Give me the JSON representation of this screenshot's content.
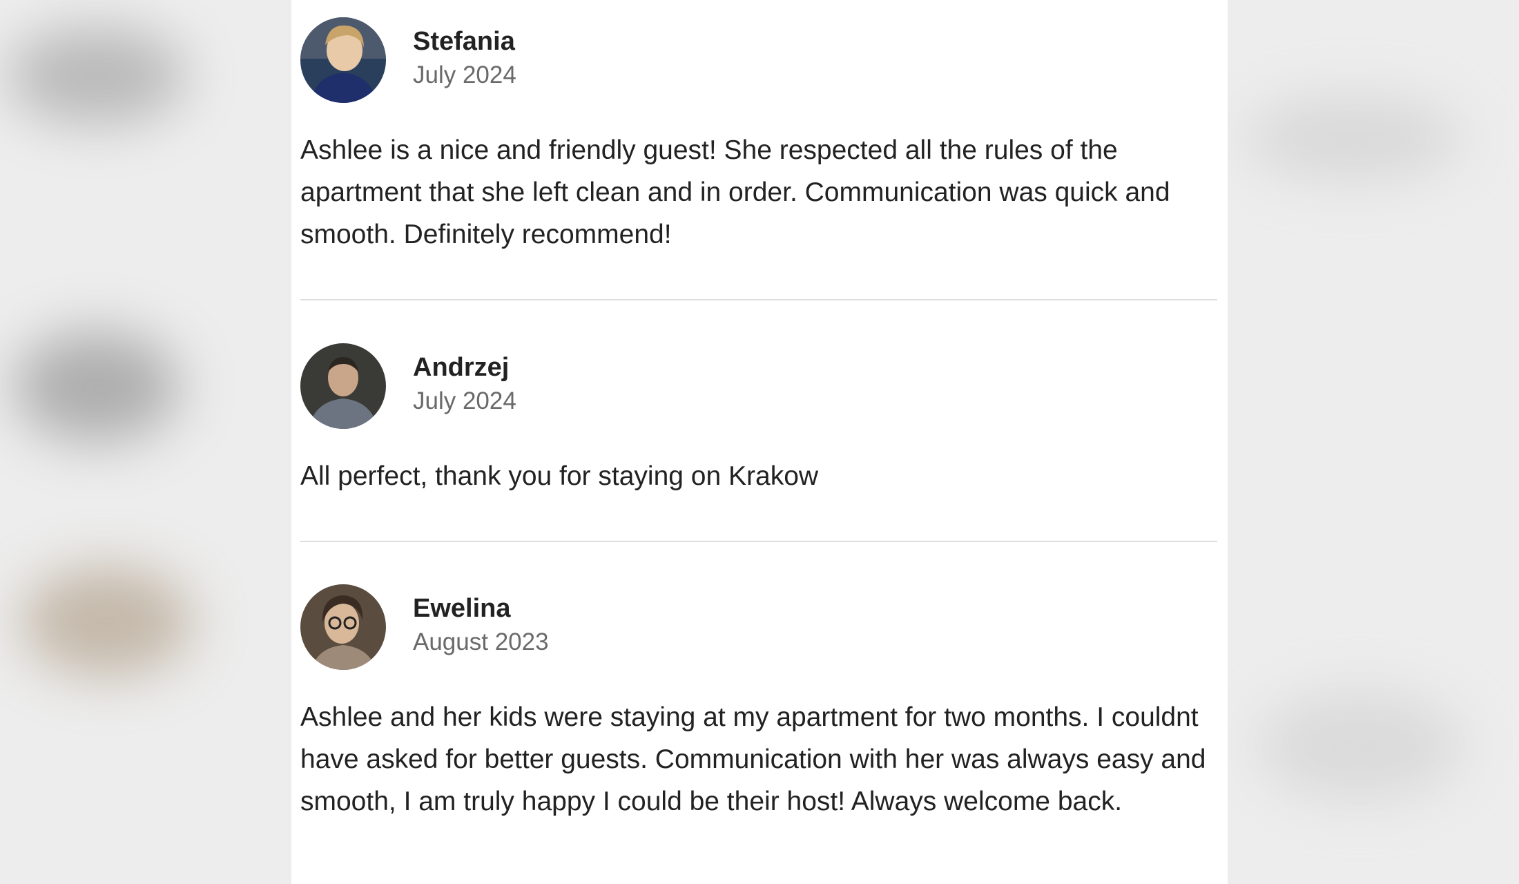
{
  "reviews": [
    {
      "name": "Stefania",
      "date": "July 2024",
      "text": "Ashlee is a nice and friendly guest! She respected all the rules of the apartment that she left clean and in order. Communication was quick and smooth. Definitely recommend!",
      "avatar_icon": "person-photo-icon"
    },
    {
      "name": "Andrzej",
      "date": "July 2024",
      "text": "All perfect, thank you for staying on Krakow",
      "avatar_icon": "person-photo-icon"
    },
    {
      "name": "Ewelina",
      "date": "August 2023",
      "text": "Ashlee and her kids were staying at my apartment for two months. I couldnt have asked for better guests. Communication with her was always easy and smooth, I am truly happy I could be their host! Always welcome back.",
      "avatar_icon": "person-photo-icon"
    }
  ],
  "colors": {
    "name": "#222222",
    "date": "#6a6a6a",
    "divider": "#dddddd",
    "panel": "#ffffff"
  }
}
